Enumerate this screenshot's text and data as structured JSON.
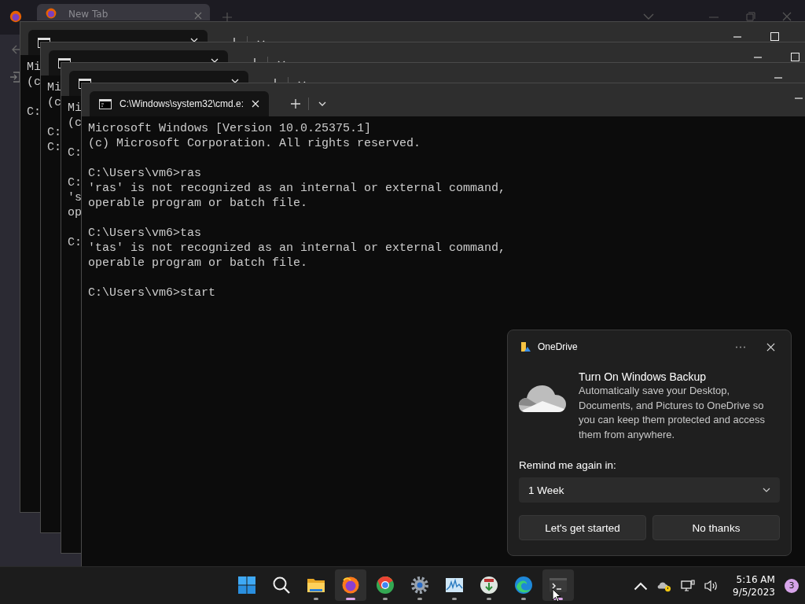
{
  "browser": {
    "tab_title": "New Tab"
  },
  "terminals": [
    {
      "blocks": [
        [
          "Mi",
          "(c"
        ],
        [
          "C:"
        ]
      ]
    },
    {
      "blocks": [
        [
          "Mi",
          "(c"
        ],
        [
          "C:",
          "C:"
        ]
      ]
    },
    {
      "blocks": [
        [
          "Mi",
          "(c"
        ],
        [
          "C:"
        ],
        [
          "C:",
          "'s",
          "op"
        ],
        [
          "C:"
        ]
      ]
    },
    {
      "title": "C:\\Windows\\system32\\cmd.e:",
      "blocks": [
        [
          "Microsoft Windows [Version 10.0.25375.1]",
          "(c) Microsoft Corporation. All rights reserved."
        ],
        [
          "C:\\Users\\vm6>ras",
          "'ras' is not recognized as an internal or external command,",
          "operable program or batch file."
        ],
        [
          "C:\\Users\\vm6>tas",
          "'tas' is not recognized as an internal or external command,",
          "operable program or batch file."
        ],
        [
          "C:\\Users\\vm6>start"
        ]
      ]
    }
  ],
  "notification": {
    "app": "OneDrive",
    "title": "Turn On Windows Backup",
    "body": "Automatically save your Desktop, Documents, and Pictures to OneDrive so you can keep them protected and access them from anywhere.",
    "remind_label": "Remind me again in:",
    "remind_value": "1 Week",
    "buttons": [
      "Let's get started",
      "No thanks"
    ]
  },
  "taskbar": {
    "apps": [
      {
        "kind": "start",
        "running": false,
        "active": false
      },
      {
        "kind": "search",
        "running": false,
        "active": false
      },
      {
        "kind": "explorer",
        "running": true,
        "active": false
      },
      {
        "kind": "firefox",
        "running": true,
        "active": true
      },
      {
        "kind": "chrome",
        "running": true,
        "active": false
      },
      {
        "kind": "settings",
        "running": true,
        "active": false
      },
      {
        "kind": "monitor",
        "running": true,
        "active": false
      },
      {
        "kind": "installer",
        "running": true,
        "active": false
      },
      {
        "kind": "edge",
        "running": true,
        "active": false
      },
      {
        "kind": "terminal",
        "running": true,
        "active": true
      }
    ],
    "time": "5:16 AM",
    "date": "9/5/2023",
    "badge": "3"
  }
}
